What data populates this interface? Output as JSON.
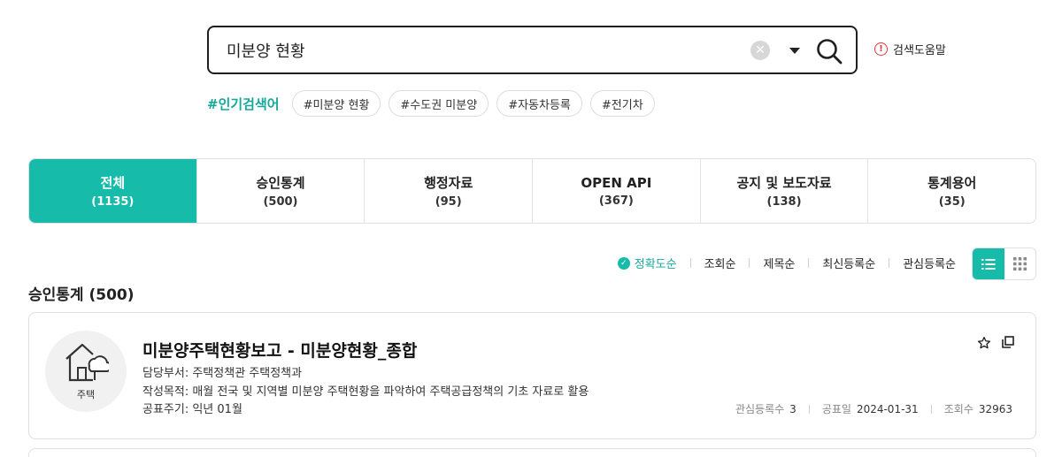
{
  "search": {
    "value": "미분양 현황",
    "help_label": "검색도움말"
  },
  "popular": {
    "label": "#인기검색어",
    "keywords": [
      "#미분양 현황",
      "#수도권 미분양",
      "#자동차등록",
      "#전기차"
    ]
  },
  "tabs": [
    {
      "label": "전체",
      "count": "(1135)"
    },
    {
      "label": "승인통계",
      "count": "(500)"
    },
    {
      "label": "행정자료",
      "count": "(95)"
    },
    {
      "label": "OPEN API",
      "count": "(367)"
    },
    {
      "label": "공지 및 보도자료",
      "count": "(138)"
    },
    {
      "label": "통계용어",
      "count": "(35)"
    }
  ],
  "sort": {
    "options": [
      "정확도순",
      "조회순",
      "제목순",
      "최신등록순",
      "관심등록순"
    ],
    "active": "정확도순"
  },
  "section_title": "승인통계 (500)",
  "card": {
    "icon_label": "주택",
    "title": "미분양주택현황보고 - 미분양현황_종합",
    "department": "담당부서: 주택정책관 주택정책과",
    "purpose": "작성목적: 매월 전국 및 지역별 미분양 주택현황을 파악하여 주택공급정책의 기초 자료로 활용",
    "cycle": "공표주기: 익년 01월",
    "meta": {
      "interest_label": "관심등록수",
      "interest_value": "3",
      "date_label": "공표일",
      "date_value": "2024-01-31",
      "views_label": "조회수",
      "views_value": "32963"
    }
  },
  "colors": {
    "accent": "#17bbaa",
    "accent_text": "#16a89a",
    "warning": "#e0383b"
  }
}
